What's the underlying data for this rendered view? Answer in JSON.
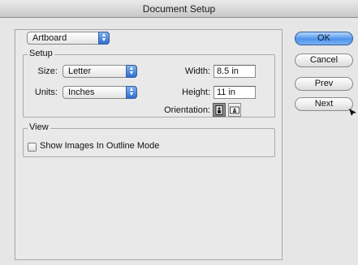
{
  "window": {
    "title": "Document Setup"
  },
  "artboard_popup": {
    "value": "Artboard"
  },
  "setup": {
    "group_label": "Setup",
    "size_label": "Size:",
    "size_value": "Letter",
    "units_label": "Units:",
    "units_value": "Inches",
    "width_label": "Width:",
    "width_value": "8.5 in",
    "height_label": "Height:",
    "height_value": "11 in",
    "orientation_label": "Orientation:"
  },
  "view": {
    "group_label": "View",
    "show_images_label": "Show Images In Outline Mode",
    "show_images_checked": false
  },
  "buttons": {
    "ok": "OK",
    "cancel": "Cancel",
    "prev": "Prev",
    "next": "Next"
  },
  "icons": {
    "popup_arrows": "up-down-arrows-icon",
    "portrait": "portrait-orientation-icon",
    "landscape": "landscape-orientation-icon"
  }
}
